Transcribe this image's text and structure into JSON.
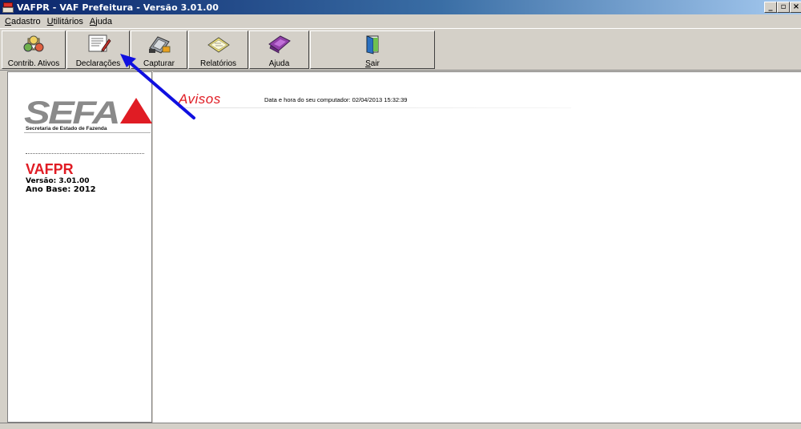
{
  "window": {
    "title": "VAFPR - VAF Prefeitura - Versão 3.01.00",
    "controls": {
      "minimize": "_",
      "maximize": "▫",
      "close": "×"
    }
  },
  "menu": [
    {
      "label": "Cadastro",
      "accel": "C"
    },
    {
      "label": "Utilitários",
      "accel": "U"
    },
    {
      "label": "Ajuda",
      "accel": "A"
    }
  ],
  "toolbar": [
    {
      "label": "Contrib. Ativos",
      "icon": "contributors-icon"
    },
    {
      "label": "Declarações",
      "icon": "declarations-icon"
    },
    {
      "label": "Capturar",
      "icon": "capture-icon"
    },
    {
      "label": "Relatórios",
      "icon": "reports-icon"
    },
    {
      "label": "Ajuda",
      "icon": "help-icon"
    },
    {
      "label": "Sair",
      "icon": "exit-door-icon",
      "accel": "S"
    }
  ],
  "sidebar": {
    "logo_text": "SEFA",
    "logo_subtitle": "Secretaria de Estado de Fazenda",
    "app_name": "VAFPR",
    "version": "Versão: 3.01.00",
    "base_year": "Ano Base: 2012"
  },
  "main": {
    "heading": "Avisos",
    "datetime": "Data e hora do seu computador: 02/04/2013 15:32:39"
  },
  "colors": {
    "title_bar": "#0a246a",
    "window_face": "#d4d0c8",
    "accent_red": "#e01c24",
    "annotation_arrow": "#1010e0"
  }
}
